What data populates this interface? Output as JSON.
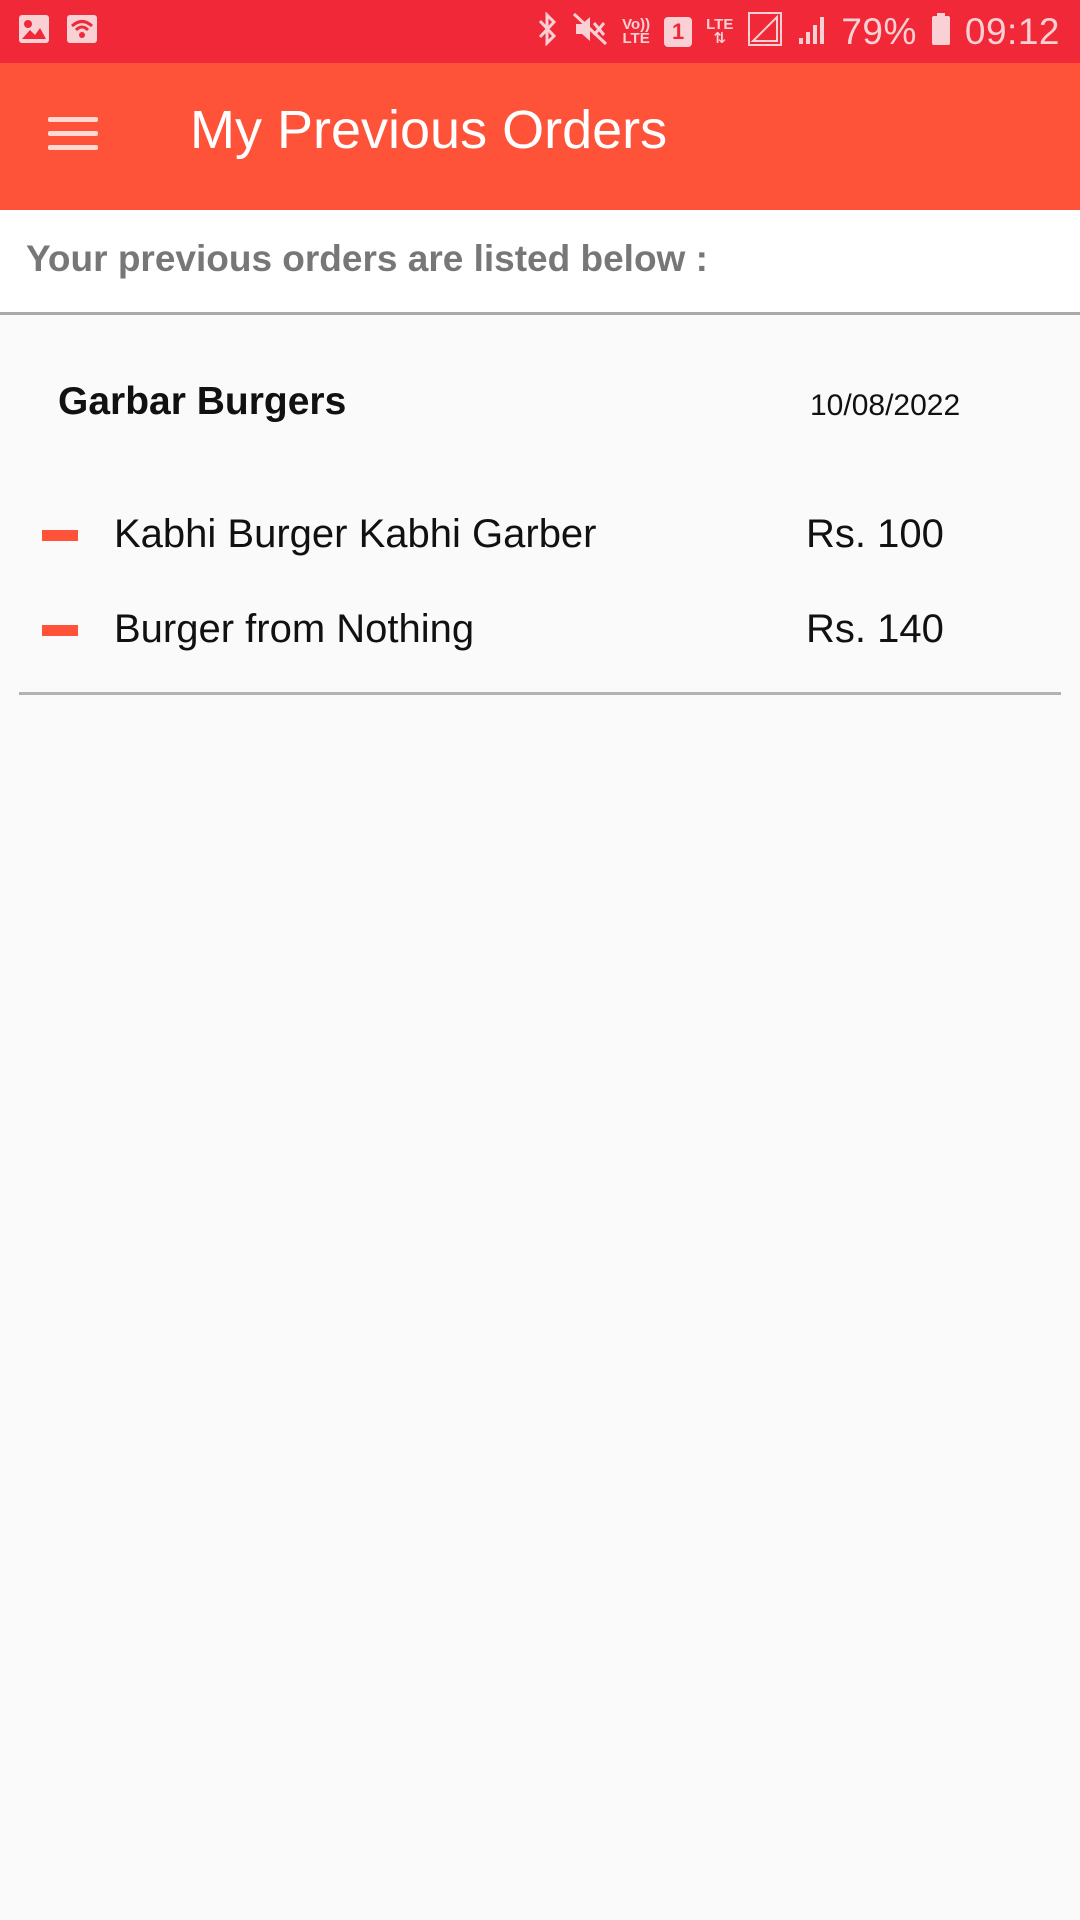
{
  "status_bar": {
    "volte_label_top": "Vo))",
    "volte_label_bottom": "LTE",
    "sim_label": "1",
    "lte_label": "LTE",
    "battery": "79%",
    "time": "09:12",
    "icons": [
      "gallery-icon",
      "wifi-icon",
      "bluetooth-icon",
      "mute-icon",
      "signal-icon",
      "battery-icon"
    ]
  },
  "app_bar": {
    "title": "My Previous Orders",
    "menu_icon": "hamburger-menu-icon"
  },
  "subheader": {
    "text": "Your previous orders are listed below :"
  },
  "orders": [
    {
      "restaurant": "Garbar Burgers",
      "date": "10/08/2022",
      "items": [
        {
          "name": "Kabhi Burger Kabhi Garber",
          "price": "Rs. 100"
        },
        {
          "name": "Burger from Nothing",
          "price": "Rs. 140"
        }
      ]
    }
  ],
  "colors": {
    "status_bar": "#f02837",
    "app_bar": "#ff5339",
    "accent": "#ff5339",
    "background": "#fafafa"
  }
}
